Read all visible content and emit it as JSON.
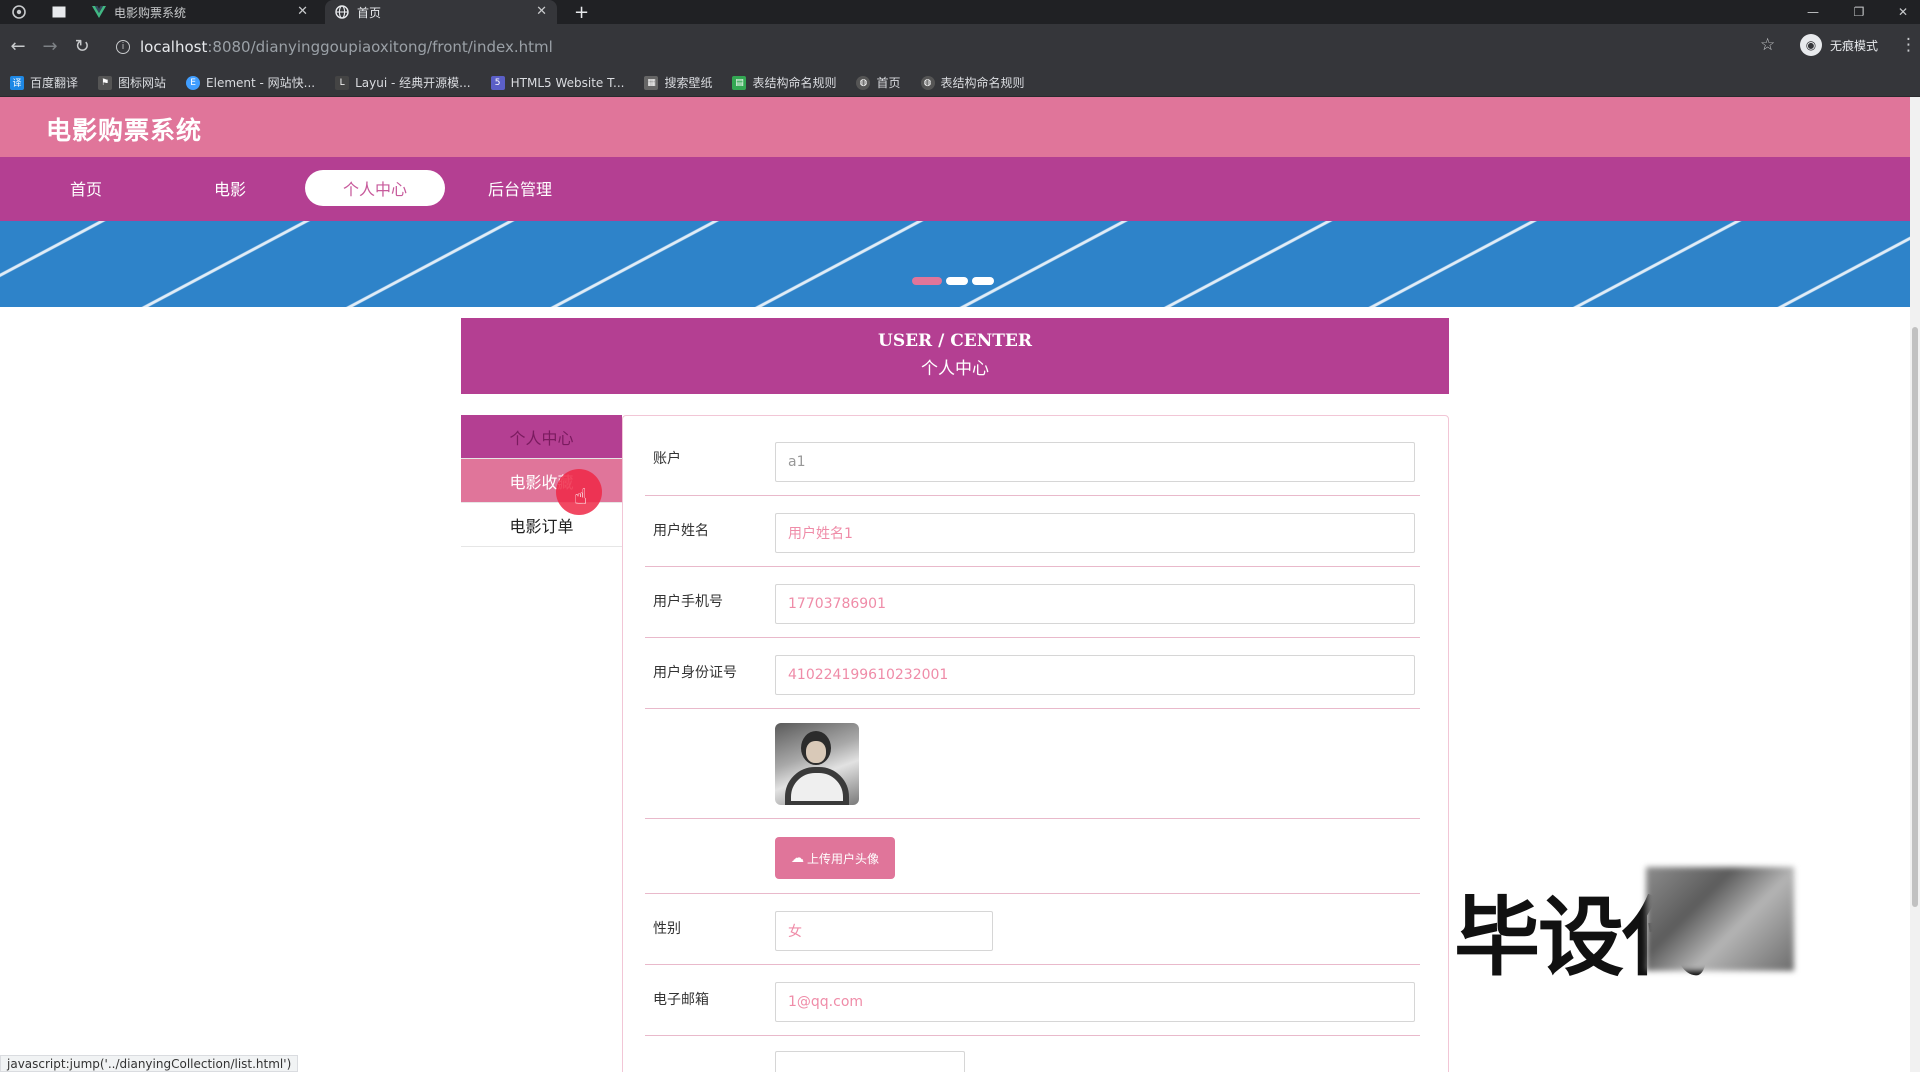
{
  "browser": {
    "tabs": [
      {
        "title": "电影购票系统"
      },
      {
        "title": "首页"
      }
    ],
    "new_tab": "+",
    "url_host": "localhost",
    "url_rest": ":8080/dianyinggoupiaoxitong/front/index.html",
    "profile_label": "无痕模式",
    "bookmarks": [
      {
        "label": "百度翻译",
        "color": "#1e88e5",
        "icon": "translate-icon"
      },
      {
        "label": "图标网站",
        "color": "#555555",
        "icon": "flag-icon"
      },
      {
        "label": "Element - 网站快...",
        "color": "#409eff",
        "icon": "element-icon"
      },
      {
        "label": "Layui - 经典开源模...",
        "color": "#444444",
        "icon": "layui-icon"
      },
      {
        "label": "HTML5 Website T...",
        "color": "#5b5fc7",
        "icon": "html5-icon"
      },
      {
        "label": "搜索壁纸",
        "color": "#666666",
        "icon": "wallpaper-icon"
      },
      {
        "label": "表结构命名规则",
        "color": "#34a853",
        "icon": "table-icon"
      },
      {
        "label": "首页",
        "color": "#555555",
        "icon": "globe-icon"
      },
      {
        "label": "表结构命名规则",
        "color": "#555555",
        "icon": "globe-icon"
      }
    ]
  },
  "site": {
    "title": "电影购票系统",
    "nav": [
      "首页",
      "电影",
      "个人中心",
      "后台管理"
    ],
    "active_nav_index": 2
  },
  "user_center": {
    "title_en": "USER / CENTER",
    "title_cn": "个人中心"
  },
  "side_menu": [
    "个人中心",
    "电影收藏",
    "电影订单"
  ],
  "form": {
    "account_label": "账户",
    "account_value": "a1",
    "name_label": "用户姓名",
    "name_value": "用户姓名1",
    "phone_label": "用户手机号",
    "phone_value": "17703786901",
    "idcard_label": "用户身份证号",
    "idcard_value": "410224199610232001",
    "upload_label": "上传用户头像",
    "gender_label": "性别",
    "gender_value": "女",
    "email_label": "电子邮箱",
    "email_value": "1@qq.com"
  },
  "watermark_text": "毕设代",
  "status_tip": "javascript:jump('../dianyingCollection/list.html')"
}
